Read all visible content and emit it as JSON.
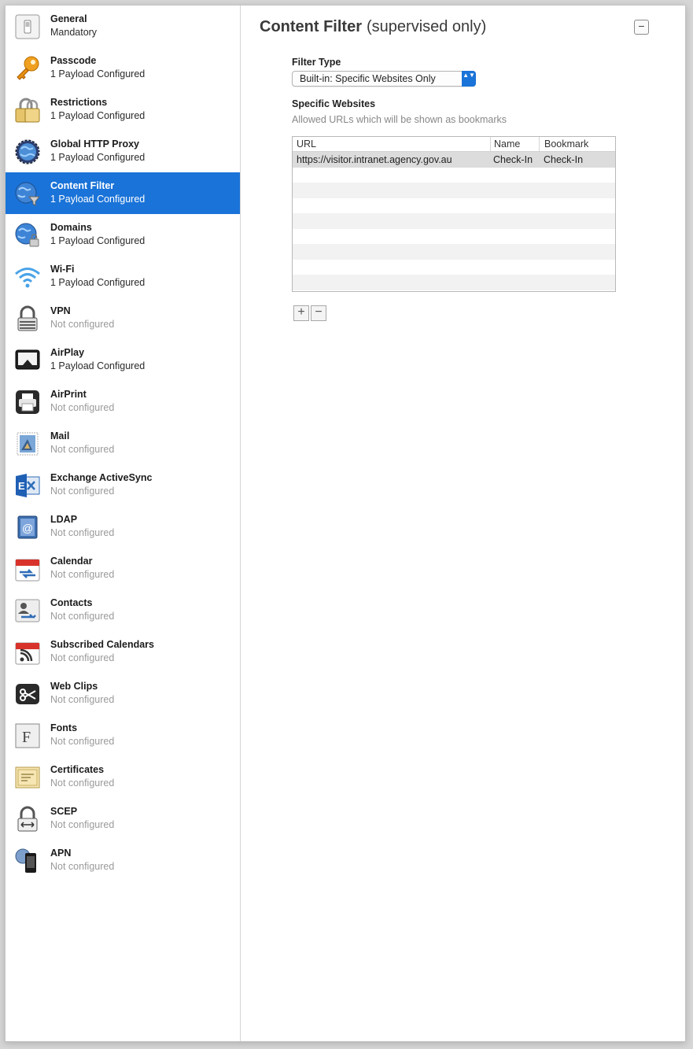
{
  "sidebar": {
    "items": [
      {
        "title": "General",
        "status": "Mandatory",
        "icon": "switch-icon",
        "muted": false
      },
      {
        "title": "Passcode",
        "status": "1 Payload Configured",
        "icon": "key-icon",
        "muted": false
      },
      {
        "title": "Restrictions",
        "status": "1 Payload Configured",
        "icon": "padlock-gold-icon",
        "muted": false
      },
      {
        "title": "Global HTTP Proxy",
        "status": "1 Payload Configured",
        "icon": "globe-proxy-icon",
        "muted": false
      },
      {
        "title": "Content Filter",
        "status": "1 Payload Configured",
        "icon": "globe-filter-icon",
        "muted": false,
        "selected": true
      },
      {
        "title": "Domains",
        "status": "1 Payload Configured",
        "icon": "globe-domain-icon",
        "muted": false
      },
      {
        "title": "Wi-Fi",
        "status": "1 Payload Configured",
        "icon": "wifi-icon",
        "muted": false
      },
      {
        "title": "VPN",
        "status": "Not configured",
        "icon": "vpn-lock-icon",
        "muted": true
      },
      {
        "title": "AirPlay",
        "status": "1 Payload Configured",
        "icon": "airplay-icon",
        "muted": false
      },
      {
        "title": "AirPrint",
        "status": "Not configured",
        "icon": "printer-icon",
        "muted": true
      },
      {
        "title": "Mail",
        "status": "Not configured",
        "icon": "mail-stamp-icon",
        "muted": true
      },
      {
        "title": "Exchange ActiveSync",
        "status": "Not configured",
        "icon": "exchange-icon",
        "muted": true
      },
      {
        "title": "LDAP",
        "status": "Not configured",
        "icon": "ldap-at-icon",
        "muted": true
      },
      {
        "title": "Calendar",
        "status": "Not configured",
        "icon": "calendar-icon",
        "muted": true
      },
      {
        "title": "Contacts",
        "status": "Not configured",
        "icon": "contacts-icon",
        "muted": true
      },
      {
        "title": "Subscribed Calendars",
        "status": "Not configured",
        "icon": "subscribed-calendar-icon",
        "muted": true
      },
      {
        "title": "Web Clips",
        "status": "Not configured",
        "icon": "scissors-icon",
        "muted": true
      },
      {
        "title": "Fonts",
        "status": "Not configured",
        "icon": "font-icon",
        "muted": true
      },
      {
        "title": "Certificates",
        "status": "Not configured",
        "icon": "certificate-icon",
        "muted": true
      },
      {
        "title": "SCEP",
        "status": "Not configured",
        "icon": "scep-lock-icon",
        "muted": true
      },
      {
        "title": "APN",
        "status": "Not configured",
        "icon": "apn-phone-icon",
        "muted": true
      }
    ]
  },
  "main": {
    "title": "Content Filter",
    "subtitle": "(supervised only)",
    "collapse_label": "−",
    "filter_type_label": "Filter Type",
    "filter_type_value": "Built-in: Specific Websites Only",
    "filter_type_arrows": "▲▼",
    "specific_websites_label": "Specific Websites",
    "specific_websites_hint": "Allowed URLs which will be shown as bookmarks",
    "table": {
      "columns": [
        "URL",
        "Name",
        "Bookmark"
      ],
      "rows": [
        [
          "https://visitor.intranet.agency.gov.au",
          "Check-In",
          "Check-In"
        ]
      ]
    },
    "add_label": "+",
    "remove_label": "−"
  },
  "colors": {
    "selection": "#1a73d8",
    "background": "#d6d6d6"
  }
}
